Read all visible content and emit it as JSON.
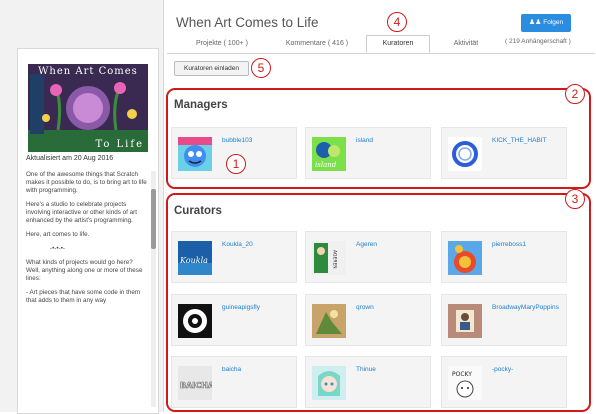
{
  "studio": {
    "title": "When Art Comes to Life",
    "follow_label": "Folgen",
    "followers": "( 219 Anhängerschaft )",
    "tabs": [
      {
        "label": "Projekte ( 100+ )"
      },
      {
        "label": "Kommentare ( 416 )"
      },
      {
        "label": "Kuratoren"
      },
      {
        "label": "Aktivität"
      }
    ],
    "active_tab": "Kuratoren"
  },
  "sidebar": {
    "thumb_title": "When Art Comes",
    "thumb_sub": "To Life",
    "updated": "Aktualisiert am 20 Aug 2016",
    "description": [
      "One of the awesome things that Scratch makes it possible to do, is to bring art to life with programming.",
      "Here's a studio to celebrate projects involving interactive or other kinds of art enhanced by the artist's programming.",
      "Here, art comes to life.",
      "-•-•-•-",
      "What kinds of projects would go here? Well, anything along one or more of these lines:",
      "- Art pieces that have some code in them that adds to them in any way"
    ]
  },
  "invite_label": "Kuratoren einladen",
  "managers": {
    "heading": "Managers",
    "items": [
      {
        "name": "bubble103"
      },
      {
        "name": "island"
      },
      {
        "name": "KICK_THE_HABIT"
      }
    ]
  },
  "curators": {
    "heading": "Curators",
    "items": [
      {
        "name": "Koukla_20"
      },
      {
        "name": "Ageren"
      },
      {
        "name": "pierreboss1"
      },
      {
        "name": "guineapigsfly"
      },
      {
        "name": "qrown"
      },
      {
        "name": "BroadwayMaryPoppins"
      },
      {
        "name": "baicha"
      },
      {
        "name": "Thinue"
      },
      {
        "name": "-pocky-"
      }
    ]
  },
  "annotations": [
    "1",
    "2",
    "3",
    "4",
    "5"
  ],
  "avatar_text": {
    "koukla": "Koukla",
    "ageren": "AGEREN",
    "baicha": "BAICHA",
    "pocky": "POCKY",
    "island": "island"
  },
  "colors": {
    "accent": "#2a8de0",
    "link": "#1b7fcc",
    "annotation": "#d01a1a"
  }
}
